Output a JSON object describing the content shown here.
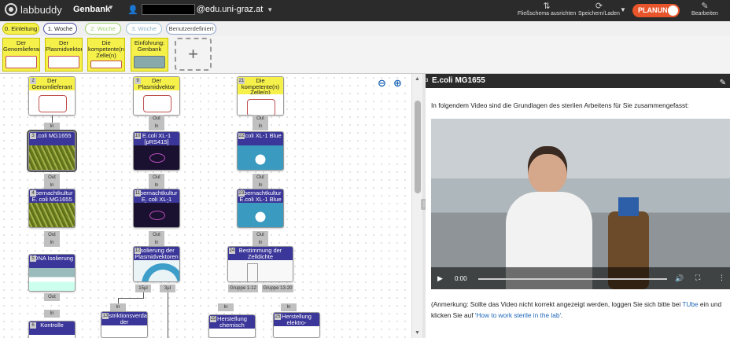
{
  "topbar": {
    "logo": "labbuddy",
    "bank": "Genbank",
    "email_domain": "@edu.uni-graz.at",
    "flowchart_btn": "Fließschema ausrichten",
    "save_btn": "Speichern/Laden",
    "mode": "PLANUNG",
    "edit_btn": "Bearbeiten"
  },
  "tabs": [
    {
      "label": "0. Einleitung"
    },
    {
      "label": "1. Woche"
    },
    {
      "label": "2. Woche"
    },
    {
      "label": "3. Woche"
    },
    {
      "label": "Benutzerdefiniert"
    }
  ],
  "thumbs": [
    {
      "label": "Der Genomlieferant"
    },
    {
      "label": "Der Plasmidvektor"
    },
    {
      "label": "Die kompetente(n) Zelle(n)"
    },
    {
      "label": "Einführung: Genbank"
    }
  ],
  "add_thumb": "+",
  "nodes": {
    "n2": {
      "num": "2",
      "title": "Der Genomlieferant"
    },
    "n9": {
      "num": "9",
      "title": "Der Plasmidvektor"
    },
    "n21": {
      "num": "21",
      "title": "Die kompetente(n) Zelle(n)"
    },
    "n3": {
      "num": "3",
      "title": "E.coli MG1655"
    },
    "n10": {
      "num": "10",
      "title": "E.coli XL-1 [pRS415]"
    },
    "n22": {
      "num": "22",
      "title": "E.coli XL-1 Blue"
    },
    "n4": {
      "num": "4",
      "title": "Übernachtkultur E. coli MG1655"
    },
    "n11": {
      "num": "11",
      "title": "Übernachtkultur E. coli XL-1 [pRS415]"
    },
    "n23": {
      "num": "23",
      "title": "Übernachtkultur E.coli XL-1 Blue"
    },
    "n5": {
      "num": "5",
      "title": "gDNA Isolierung"
    },
    "n12": {
      "num": "12",
      "title": "Isolierung der Plasmidvektoren"
    },
    "n24": {
      "num": "24",
      "title": "Bestimmung der Zelldichte"
    },
    "n6": {
      "num": "6",
      "title": "Kontrolle"
    },
    "n13": {
      "num": "13",
      "title": "Restriktionsverdau der"
    },
    "n25": {
      "num": "25",
      "title": "Herstellung chemisch"
    },
    "n26": {
      "num": "25",
      "title": "Herstellung elektro-"
    }
  },
  "conn": {
    "in": "In",
    "out": "Out",
    "out_15": "15µl",
    "out_3": "3µl",
    "g1": "Gruppe 1-12",
    "g2": "Gruppe 13-20"
  },
  "panel": {
    "num": "3",
    "title": "E.coli MG1655",
    "intro": "In folgendem Video sind die Grundlagen des sterilen Arbeitens für Sie zusammengefasst:",
    "video_time": "0:00",
    "note_pre": "(Anmerkung: Sollte das Video nicht korrekt angezeigt werden, loggen Sie sich bitte bei ",
    "note_link1": "TUbe",
    "note_mid": " ein und klicken Sie auf ",
    "note_link2": "'How to work sterile in the lab'",
    "note_post": "."
  },
  "colors": {
    "accent": "#e8552a",
    "node_header": "#3b3699",
    "link": "#1e66b8",
    "step_yellow": "#f6f14a"
  }
}
